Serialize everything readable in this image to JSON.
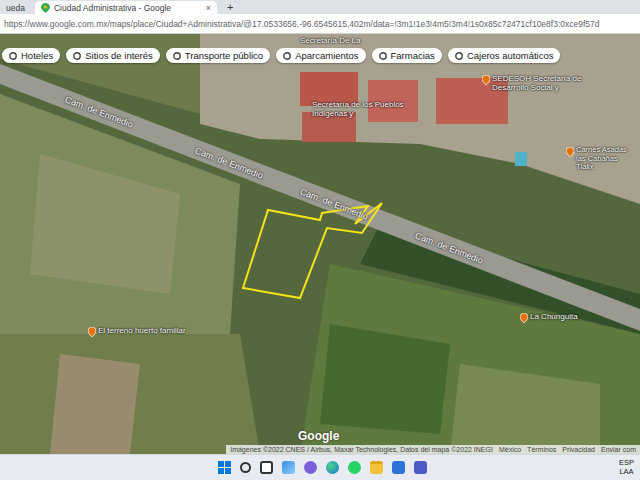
{
  "browser": {
    "tabs": [
      {
        "label": "ueda",
        "selected": false
      },
      {
        "label": "Ciudad Administrativa - Google",
        "selected": true
      }
    ],
    "close_tab": "×",
    "new_tab": "+",
    "url": "https://www.google.com.mx/maps/place/Ciudad+Administrativa/@17.0533656,-96.6545615,402m/data=!3m1!1e3!4m5!3m4!1s0x85c72471cf10e8f3:0xce9f57d"
  },
  "map": {
    "chips": [
      "Hoteles",
      "Sitios de interés",
      "Transporte público",
      "Aparcamientos",
      "Farmacias",
      "Cajeros automáticos"
    ],
    "roads": [
      "Cam. de Enmedio",
      "Cam. de Enmedio",
      "Cam. de Enmedio",
      "Cam. de Enmedio"
    ],
    "places": [
      {
        "text": "Secretaría De La",
        "kind": "plain"
      },
      {
        "text": "Secretaría de los Pueblos Indígenas y",
        "kind": "plain"
      },
      {
        "text": "SEDESOH Secretaría de Desarrollo Social y",
        "kind": "pin"
      },
      {
        "text": "Carnes Asadas las Cabañas Tlalix",
        "kind": "pin"
      },
      {
        "text": "La Chunguita",
        "kind": "pin"
      },
      {
        "text": "El terreno huerto familiar",
        "kind": "pin"
      }
    ],
    "logo": "Google",
    "attribution": [
      "Imágenes ©2022 CNES / Airbus, Maxar Technologies, Datos del mapa ©2022 INEGI",
      "México",
      "Términos",
      "Privacidad",
      "Enviar com"
    ]
  },
  "taskbar": {
    "language": "ESP",
    "layout": "LAA"
  }
}
